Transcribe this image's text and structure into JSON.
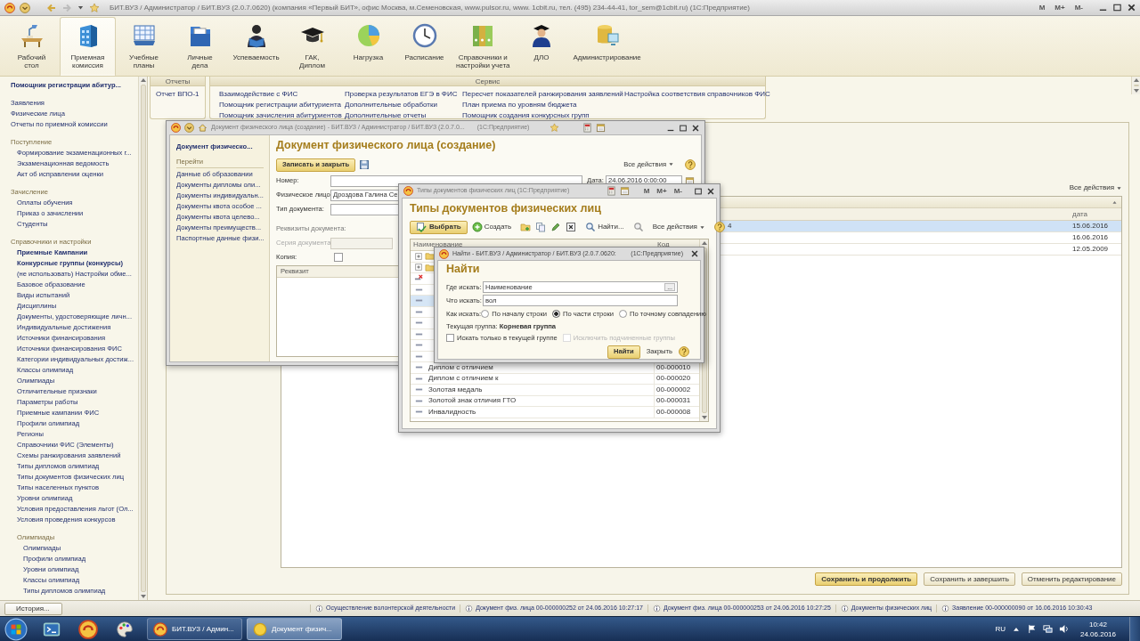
{
  "app": {
    "title": "БИТ.ВУЗ / Администратор / БИТ.ВУЗ (2.0.7.0620) (компания «Первый БИТ», офис Москва, м.Семеновская, www.pulsor.ru, www. 1cbit.ru, тел. (495) 234-44-41, tor_sem@1cbit.ru)  (1С:Предприятие)",
    "memory_buttons": [
      "M",
      "M+",
      "M-"
    ]
  },
  "sections": [
    {
      "label": "Рабочий\nстол",
      "selected": false
    },
    {
      "label": "Приемная\nкомиссия",
      "selected": true
    },
    {
      "label": "Учебные\nпланы",
      "selected": false
    },
    {
      "label": "Личные\nдела",
      "selected": false
    },
    {
      "label": "Успеваемость",
      "selected": false
    },
    {
      "label": "ГАК,\nДиплом",
      "selected": false
    },
    {
      "label": "Нагрузка",
      "selected": false
    },
    {
      "label": "Расписание",
      "selected": false
    },
    {
      "label": "Справочники и\nнастройки учета",
      "selected": false
    },
    {
      "label": "ДЛО",
      "selected": false
    },
    {
      "label": "Администрирование",
      "selected": false
    }
  ],
  "nav": {
    "title": "Помощник регистрации абитур...",
    "groups": [
      {
        "items": [
          {
            "label": "Заявления"
          },
          {
            "label": "Физические лица"
          },
          {
            "label": "Отчеты по приемной комиссии"
          }
        ]
      },
      {
        "heading": "Поступление",
        "items": [
          {
            "label": "Формирование экзаменационных г..."
          },
          {
            "label": "Экзаменационная ведомость"
          },
          {
            "label": "Акт об исправлении оценки"
          }
        ]
      },
      {
        "heading": "Зачисление",
        "items": [
          {
            "label": "Оплаты обучения"
          },
          {
            "label": "Приказ о зачислении"
          },
          {
            "label": "Студенты"
          }
        ]
      },
      {
        "heading": "Справочники и настройки",
        "items": [
          {
            "label": "Приемные Кампании",
            "bold": true
          },
          {
            "label": "Конкурсные группы (конкурсы)",
            "bold": true
          },
          {
            "label": "(не использовать) Настройки обме...",
            "bold": false
          },
          {
            "label": "Базовое образование",
            "bold": false
          },
          {
            "label": "Виды испытаний",
            "bold": false
          },
          {
            "label": "Дисциплины",
            "bold": false
          },
          {
            "label": "Документы, удостоверяющие личн...",
            "bold": false
          },
          {
            "label": "Индивидуальные достижения",
            "bold": false
          },
          {
            "label": "Источники финансирования",
            "bold": false
          },
          {
            "label": "Источники финансирования ФИС",
            "bold": false
          },
          {
            "label": "Категории индивидуальных достиж...",
            "bold": false
          },
          {
            "label": "Классы олимпиад",
            "bold": false
          },
          {
            "label": "Олимпиады",
            "bold": false
          },
          {
            "label": "Отличительные признаки",
            "bold": false
          },
          {
            "label": "Параметры работы",
            "bold": false
          },
          {
            "label": "Приемные кампании ФИС",
            "bold": false
          },
          {
            "label": "Профили олимпиад",
            "bold": false
          },
          {
            "label": "Регионы",
            "bold": false
          },
          {
            "label": "Справочники ФИС (Элементы)",
            "bold": false
          },
          {
            "label": "Схемы ранжирования заявлений",
            "bold": false
          },
          {
            "label": "Типы дипломов олимпиад",
            "bold": false
          },
          {
            "label": "Типы документов физических лиц",
            "bold": false
          },
          {
            "label": "Типы населенных пунктов",
            "bold": false
          },
          {
            "label": "Уровни олимпиад",
            "bold": false
          },
          {
            "label": "Условия предоставления льгот (Ол...",
            "bold": false
          },
          {
            "label": "Условия проведения конкурсов",
            "bold": false
          }
        ],
        "children": [
          {
            "heading": "Олимпиады",
            "items": [
              {
                "label": "Олимпиады"
              },
              {
                "label": "Профили олимпиад"
              },
              {
                "label": "Уровни олимпиад"
              },
              {
                "label": "Классы олимпиад"
              },
              {
                "label": "Типы дипломов олимпиад"
              }
            ]
          }
        ]
      }
    ]
  },
  "reports": {
    "title": "Отчеты",
    "items": [
      "Отчет ВПО-1"
    ]
  },
  "service": {
    "title": "Сервис",
    "columns": [
      [
        "Взаимодействие  с ФИС",
        "Помощник регистрации абитуриента",
        "Помощник зачисления абитуриентов"
      ],
      [
        "Проверка результатов ЕГЭ в ФИС",
        "Дополнительные обработки",
        "Дополнительные отчеты"
      ],
      [
        "Пересчет показателей ранжирования заявлений",
        "План приема по уровням бюджета",
        "Помощник создания конкурсных групп"
      ],
      [
        "Настройка соответствия справочников ФИС"
      ]
    ]
  },
  "main_form": {
    "all_actions": "Все действия",
    "table": {
      "columns": [
        "дата"
      ],
      "rows": [
        {
          "column_1": "4",
          "date": "15.06.2016",
          "selected": true
        },
        {
          "date": "16.06.2016",
          "selected": false
        },
        {
          "date": "12.05.2009",
          "selected": false
        }
      ]
    },
    "buttons": [
      {
        "label": "Сохранить и продолжить",
        "default": true
      },
      {
        "label": "Сохранить и завершить",
        "default": false
      },
      {
        "label": "Отменить редактирование",
        "default": false
      }
    ]
  },
  "document_window": {
    "title": "Документ физического лица (создание) - БИТ.ВУЗ / Администратор / БИТ.ВУЗ (2.0.7.0...",
    "title_suffix": "(1С:Предприятие)",
    "nav_title": "Документ физическо...",
    "nav_heading": "Перейти",
    "nav_items": [
      "Данные об образовании",
      "Документы дипломы оли...",
      "Документы индивидуальн...",
      "Документы квота особое ...",
      "Документы квота целево...",
      "Документы преимуществ...",
      "Паспортные данные физи..."
    ],
    "heading": "Документ физического лица (создание)",
    "save_close_button": "Записать и закрыть",
    "all_actions": "Все действия",
    "number_label": "Номер:",
    "date_label": "Дата:",
    "date_value": "24.06.2016  0:00:00",
    "person_label": "Физическое лицо:",
    "person_value": "Дроздова Галина Се",
    "type_label": "Тип документа:",
    "details_label": "Реквизиты документа:",
    "series_label": "Серия документа:",
    "series_disabled": true,
    "copy_label": "Копия:",
    "copy_checked": false,
    "table_column": "Реквизит"
  },
  "types_window": {
    "title": "Типы документов физических лиц  (1С:Предприятие)",
    "memory_buttons": [
      "M",
      "M+",
      "M-"
    ],
    "heading": "Типы документов физических лиц",
    "toolbar": {
      "select": "Выбрать",
      "create": "Создать",
      "find": "Найти...",
      "all_actions": "Все действия"
    },
    "columns": [
      "Наименование",
      "Код"
    ],
    "covered_rows": [
      {
        "kind": "group",
        "selected": false
      },
      {
        "kind": "group",
        "selected": false
      },
      {
        "kind": "deleted",
        "selected": false
      },
      {
        "kind": "item",
        "selected": false
      },
      {
        "kind": "item",
        "selected": true
      },
      {
        "kind": "item",
        "selected": false
      },
      {
        "kind": "item",
        "selected": false
      },
      {
        "kind": "item",
        "selected": false
      },
      {
        "kind": "item",
        "selected": false
      },
      {
        "kind": "item",
        "selected": false
      }
    ],
    "rows": [
      {
        "kind": "item",
        "name": "Диплом с отличием",
        "code": "00-000010",
        "selected": false
      },
      {
        "kind": "item",
        "name": "Диплом с отличием к",
        "code": "00-000020",
        "selected": false
      },
      {
        "kind": "item",
        "name": "Золотая медаль",
        "code": "00-000002",
        "selected": false
      },
      {
        "kind": "item",
        "name": "Золотой знак отличия ГТО",
        "code": "00-000031",
        "selected": false
      },
      {
        "kind": "item",
        "name": "Инвалидность",
        "code": "00-000008",
        "selected": false
      }
    ]
  },
  "find_window": {
    "title": "Найти - БИТ.ВУЗ / Администратор / БИТ.ВУЗ (2.0.7.0620:",
    "title_suffix": "(1С:Предприятие)",
    "heading": "Найти",
    "where_label": "Где искать:",
    "where_value": "Наименование",
    "choose_button": "...",
    "what_label": "Что искать:",
    "what_value": "вол",
    "how_label": "Как искать:",
    "options": [
      {
        "label": "По началу строки",
        "selected": false
      },
      {
        "label": "По части строки",
        "selected": true
      },
      {
        "label": "По точному совпадению",
        "selected": false
      }
    ],
    "group_text": "Текущая группа: **Корневая группа**",
    "checkboxes": [
      {
        "label": "Искать только в текущей группе",
        "checked": false,
        "disabled": false
      },
      {
        "label": "Исключить подчиненные группы",
        "checked": false,
        "disabled": true
      }
    ],
    "find_button": "Найти",
    "close_button": "Закрыть"
  },
  "status_bar": {
    "history": "История...",
    "messages": [
      "Осуществление волонтерской деятельности",
      "Документ физ. лица 00-000000252 от 24.06.2016 10:27:17",
      "Документ физ. лица 00-000000253 от 24.06.2016 10:27:25",
      "Документы физических лиц",
      "Заявление 00-000000090 от 16.06.2016 10:30:43"
    ]
  },
  "taskbar": {
    "tasks": [
      {
        "label": "БИТ.ВУЗ / Админ...",
        "selected": false
      },
      {
        "label": "Документ физич...",
        "selected": true
      }
    ],
    "language": "RU",
    "time": "10:42",
    "date": "24.06.2016"
  }
}
